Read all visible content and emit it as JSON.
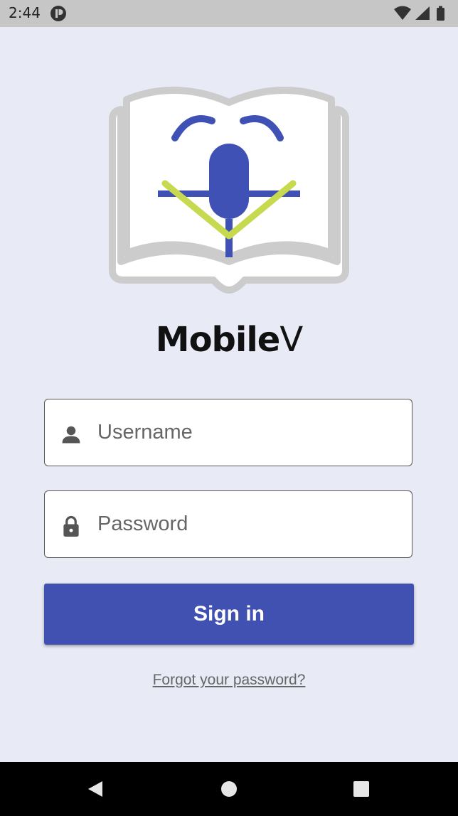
{
  "status_bar": {
    "time": "2:44",
    "icons": [
      "app-notification-icon",
      "wifi-icon",
      "cellular-signal-icon",
      "battery-icon"
    ]
  },
  "app": {
    "name_main": "Mobile",
    "name_suffix": "V",
    "logo_icon": "book-microphone-logo"
  },
  "login": {
    "username_placeholder": "Username",
    "username_value": "",
    "username_icon": "person-icon",
    "password_placeholder": "Password",
    "password_value": "",
    "password_icon": "lock-icon",
    "sign_in_label": "Sign in",
    "forgot_label": "Forgot your password?"
  },
  "nav_bar": {
    "buttons": [
      "back-icon",
      "home-icon",
      "recents-icon"
    ]
  },
  "colors": {
    "background": "#e8eaf6",
    "primary": "#4051b2",
    "logo_blue": "#3f51b5",
    "logo_green": "#c6d94f",
    "logo_gray": "#cccccc"
  }
}
